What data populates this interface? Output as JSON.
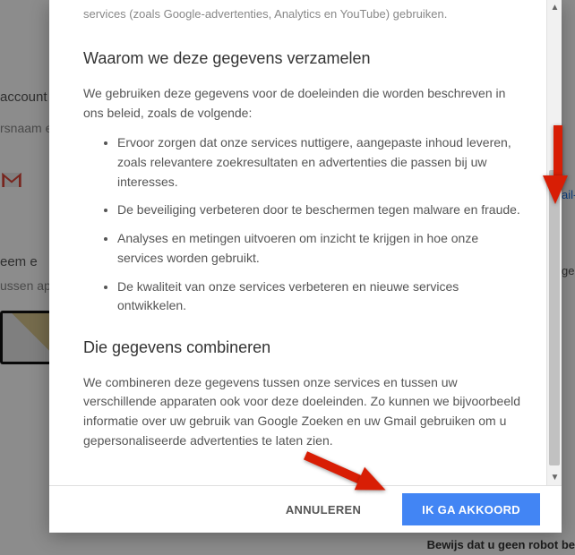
{
  "background": {
    "page_title": "Maak uw Google-account",
    "side_fragments": {
      "l1": "account",
      "l2": "rsnaam e",
      "l3": "eem e",
      "l4": "ussen ap"
    },
    "right_link": "ail-",
    "right_gen": "gen",
    "robot_text": "Bewijs dat u geen robot be"
  },
  "modal": {
    "scroll_fragment": "services (zoals Google-advertenties, Analytics en YouTube) gebruiken.",
    "section1": {
      "heading": "Waarom we deze gegevens verzamelen",
      "intro": "We gebruiken deze gegevens voor de doeleinden die worden beschreven in ons beleid, zoals de volgende:",
      "bullets": [
        "Ervoor zorgen dat onze services nuttigere, aangepaste inhoud leveren, zoals relevantere zoekresultaten en advertenties die passen bij uw interesses.",
        "De beveiliging verbeteren door te beschermen tegen malware en fraude.",
        "Analyses en metingen uitvoeren om inzicht te krijgen in hoe onze services worden gebruikt.",
        "De kwaliteit van onze services verbeteren en nieuwe services ontwikkelen."
      ]
    },
    "section2": {
      "heading": "Die gegevens combineren",
      "body": "We combineren deze gegevens tussen onze services en tussen uw verschillende apparaten ook voor deze doeleinden. Zo kunnen we bijvoorbeeld informatie over uw gebruik van Google Zoeken en uw Gmail gebruiken om u gepersonaliseerde advertenties te laten zien."
    },
    "buttons": {
      "cancel": "ANNULEREN",
      "agree": "IK GA AKKOORD"
    }
  }
}
